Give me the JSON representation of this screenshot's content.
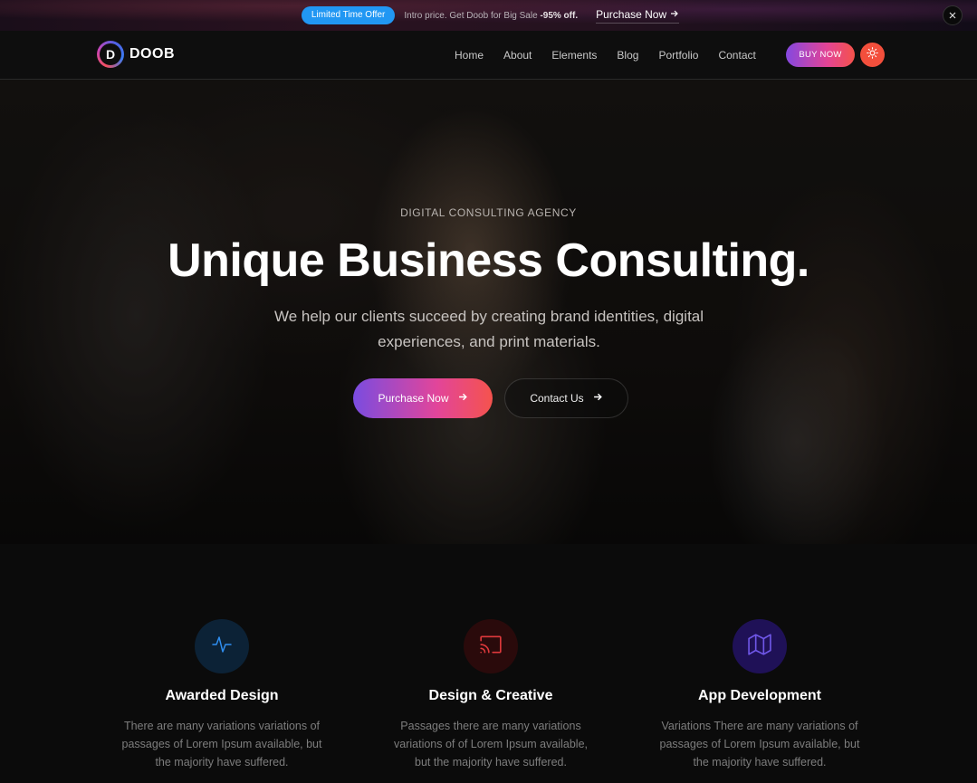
{
  "promo": {
    "badge": "Limited Time Offer",
    "text_prefix": "Intro price. Get Doob for Big Sale ",
    "text_highlight": "-95% off.",
    "link_label": "Purchase Now",
    "link_icon": "arrow-right-icon",
    "close_icon": "close-icon"
  },
  "header": {
    "logo_letter": "D",
    "logo_text": "DOOB",
    "nav": [
      {
        "label": "Home"
      },
      {
        "label": "About"
      },
      {
        "label": "Elements"
      },
      {
        "label": "Blog"
      },
      {
        "label": "Portfolio"
      },
      {
        "label": "Contact"
      }
    ],
    "buy_label": "BUY NOW",
    "theme_icon": "sun-icon"
  },
  "hero": {
    "eyebrow": "DIGITAL CONSULTING AGENCY",
    "title": "Unique Business Consulting.",
    "subtitle": "We help our clients succeed by creating brand identities, digital experiences, and print materials.",
    "primary_button": "Purchase Now",
    "secondary_button": "Contact Us"
  },
  "services": [
    {
      "icon": "activity-icon",
      "title": "Awarded Design",
      "description": "There are many variations variations of passages of Lorem Ipsum available, but the majority have suffered.",
      "color": "#2f8ef0",
      "bg": "#0c2236"
    },
    {
      "icon": "cast-icon",
      "title": "Design & Creative",
      "description": "Passages there are many variations variations of of Lorem Ipsum available, but the majority have suffered.",
      "color": "#e0393c",
      "bg": "#2a0a0b"
    },
    {
      "icon": "map-icon",
      "title": "App Development",
      "description": "Variations There are many variations of passages of Lorem Ipsum available, but the majority have suffered.",
      "color": "#6f57e8",
      "bg": "#1f1157"
    }
  ],
  "colors": {
    "promo_badge": "#2197f3",
    "gradient_start": "#8548e0",
    "gradient_mid": "#e34495",
    "gradient_end": "#f5524a",
    "theme_button": "#f34f3c"
  }
}
